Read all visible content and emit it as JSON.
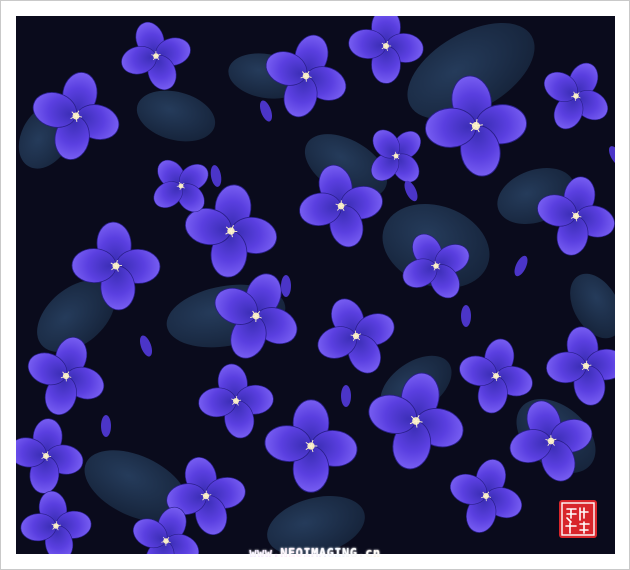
{
  "photo": {
    "subject": "purple-honesty-flowers",
    "palette": {
      "background": "#0a0b1c",
      "leaf": "#1d3350",
      "petal": "#5a3fe0",
      "petal_light": "#7b62f4",
      "center": "#f0e6c0"
    }
  },
  "watermark": {
    "text": "www.NEOIMAGING.cn"
  },
  "seal": {
    "color": "#d8252b"
  }
}
